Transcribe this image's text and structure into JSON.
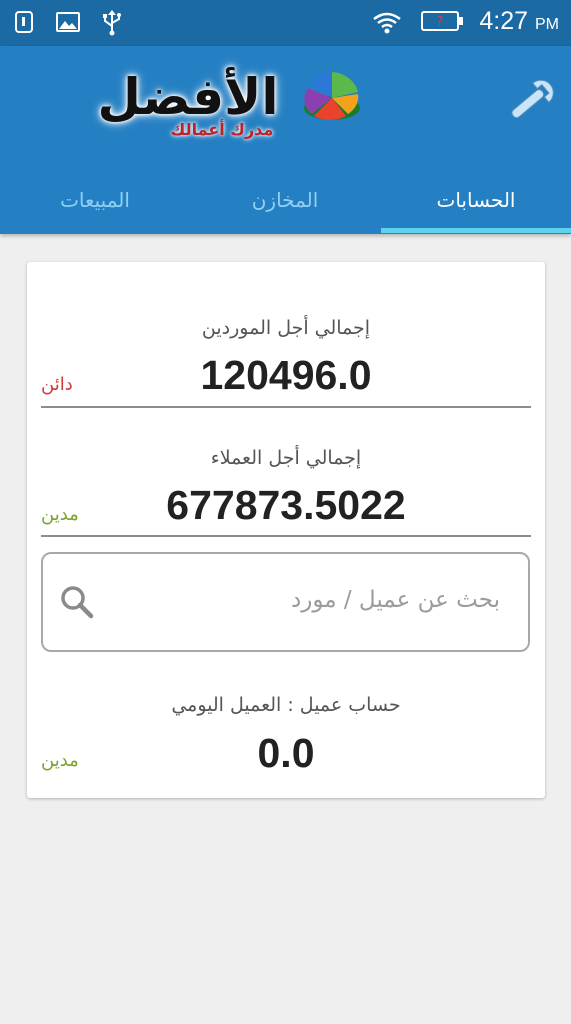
{
  "status_bar": {
    "time": "4:27",
    "ampm": "PM",
    "icons": [
      "sim-icon",
      "image-icon",
      "usb-icon",
      "wifi-icon",
      "battery-alert-icon"
    ],
    "battery_badge": "?"
  },
  "app_bar": {
    "logo_text": "الأفضل",
    "logo_subtitle": "مدرك أعمالك",
    "settings_icon": "wrench-icon"
  },
  "tabs": [
    {
      "label": "الحسابات",
      "active": true
    },
    {
      "label": "المخازن",
      "active": false
    },
    {
      "label": "المبيعات",
      "active": false
    }
  ],
  "colors": {
    "status_bar": "#1c6aa3",
    "app_bar": "#2580c3",
    "tab_indicator": "#5fd3ee",
    "credit_status": "#d6393a",
    "debit_status": "#7aa52a"
  },
  "summary": {
    "suppliers": {
      "label": "إجمالي أجل الموردين",
      "value": "120496.0",
      "status": "دائن"
    },
    "customers": {
      "label": "إجمالي أجل العملاء",
      "value": "677873.5022",
      "status": "مدين"
    }
  },
  "search": {
    "placeholder": "بحث عن عميل / مورد",
    "icon": "search-icon"
  },
  "customer_account": {
    "label": "حساب عميل : العميل اليومي",
    "value": "0.0",
    "status": "مدين"
  }
}
